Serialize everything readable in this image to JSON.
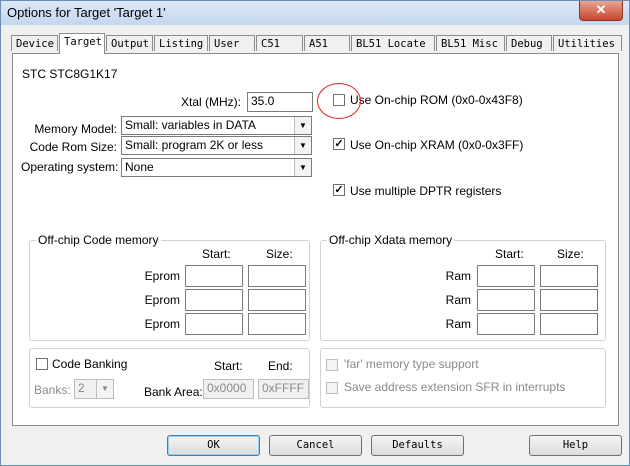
{
  "window": {
    "title": "Options for Target 'Target 1'",
    "close_glyph": "✕"
  },
  "tabs": [
    {
      "label": "Device"
    },
    {
      "label": "Target"
    },
    {
      "label": "Output"
    },
    {
      "label": "Listing"
    },
    {
      "label": "User"
    },
    {
      "label": "C51"
    },
    {
      "label": "A51"
    },
    {
      "label": "BL51 Locate"
    },
    {
      "label": "BL51 Misc"
    },
    {
      "label": "Debug"
    },
    {
      "label": "Utilities"
    }
  ],
  "active_tab": "Target",
  "device_name": "STC STC8G1K17",
  "xtal": {
    "label": "Xtal (MHz):",
    "value": "35.0"
  },
  "memory_model": {
    "label": "Memory Model:",
    "value": "Small: variables in DATA"
  },
  "code_rom_size": {
    "label": "Code Rom Size:",
    "value": "Small: program 2K or less"
  },
  "operating_system": {
    "label": "Operating system:",
    "value": "None"
  },
  "options": {
    "onchip_rom": {
      "label": "Use On-chip ROM (0x0-0x43F8)",
      "checked": false
    },
    "onchip_xram": {
      "label": "Use On-chip XRAM (0x0-0x3FF)",
      "checked": true
    },
    "multiple_dptr": {
      "label": "Use multiple DPTR registers",
      "checked": true
    }
  },
  "offchip_code": {
    "title": "Off-chip Code memory",
    "start_header": "Start:",
    "size_header": "Size:",
    "rows": [
      {
        "label": "Eprom"
      },
      {
        "label": "Eprom"
      },
      {
        "label": "Eprom"
      }
    ]
  },
  "offchip_xdata": {
    "title": "Off-chip Xdata memory",
    "start_header": "Start:",
    "size_header": "Size:",
    "rows": [
      {
        "label": "Ram"
      },
      {
        "label": "Ram"
      },
      {
        "label": "Ram"
      }
    ]
  },
  "code_banking": {
    "label": "Code Banking",
    "checked": false,
    "banks_label": "Banks:",
    "banks_value": "2",
    "bank_area_label": "Bank Area:",
    "start_header": "Start:",
    "end_header": "End:",
    "start_value": "0x0000",
    "end_value": "0xFFFF"
  },
  "far_memory": {
    "label": "'far' memory type support",
    "checked": false
  },
  "save_sfr": {
    "label": "Save address extension SFR in interrupts",
    "checked": false
  },
  "buttons": {
    "ok": "OK",
    "cancel": "Cancel",
    "defaults": "Defaults",
    "help": "Help"
  },
  "colors": {
    "highlight_circle": "#e02020",
    "title_bar": "#c4d7ef",
    "close_button": "#c7452e"
  }
}
